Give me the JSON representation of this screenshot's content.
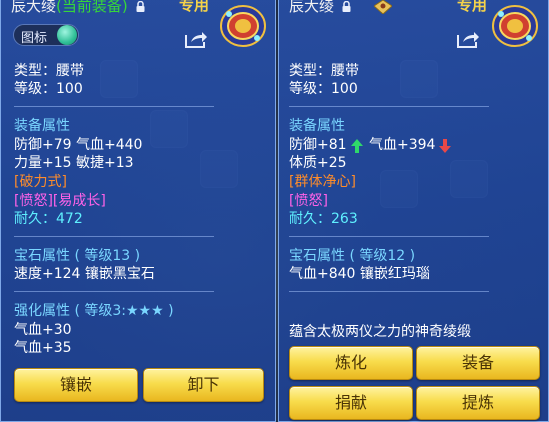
{
  "left_panel": {
    "title_name": "辰大绫",
    "title_status": "(当前装备)",
    "exclusive": "专用",
    "icon_toggle_label": "图标",
    "type": "类型：腰带",
    "level": "等级：100",
    "attr_header": "装备属性",
    "stat_line_1": "防御+79 气血+440",
    "stat_line_2": "力量+15 敏捷+13",
    "special_skill": "[破力式]",
    "special_effect": "[愤怒][易成长]",
    "durability": "耐久：472",
    "gem_header": "宝石属性 ( 等级13 )",
    "gem_line": "速度+124 镶嵌黑宝石",
    "enhance_header": "强化属性 ( 等级3:★★★ )",
    "enhance_line_1": "气血+30",
    "enhance_line_2": "气血+35",
    "button_embed": "镶嵌",
    "button_unequip": "卸下"
  },
  "right_panel": {
    "title_name": "辰大绫",
    "exclusive": "专用",
    "type": "类型：腰带",
    "level": "等级：100",
    "attr_header": "装备属性",
    "stat_def": "防御+81",
    "stat_hp": "气血+394",
    "stat_line_2": "体质+25",
    "special_skill": "[群体净心]",
    "special_effect": "[愤怒]",
    "durability": "耐久：263",
    "gem_header": "宝石属性 ( 等级12 )",
    "gem_line": "气血+840 镶嵌红玛瑙",
    "description": "蕴含太极两仪之力的神奇绫缎",
    "button_refine": "炼化",
    "button_equip": "装备",
    "button_donate": "捐献",
    "button_extract": "提炼"
  },
  "colors": {
    "panel_bg": "#2a52b0",
    "header_text": "#7ad6ff",
    "special_orange": "#ff8c2a",
    "special_magenta": "#ff62e8",
    "durability_cyan": "#5ff0ff",
    "current_equip_green": "#36d63a",
    "button_gold": "#f8dc4c",
    "up_arrow": "#2fd86a",
    "down_arrow": "#e84848"
  },
  "icons": [
    "lock-icon",
    "emblem-icon",
    "share-icon",
    "up-arrow-icon",
    "down-arrow-icon",
    "toggle-switch"
  ]
}
